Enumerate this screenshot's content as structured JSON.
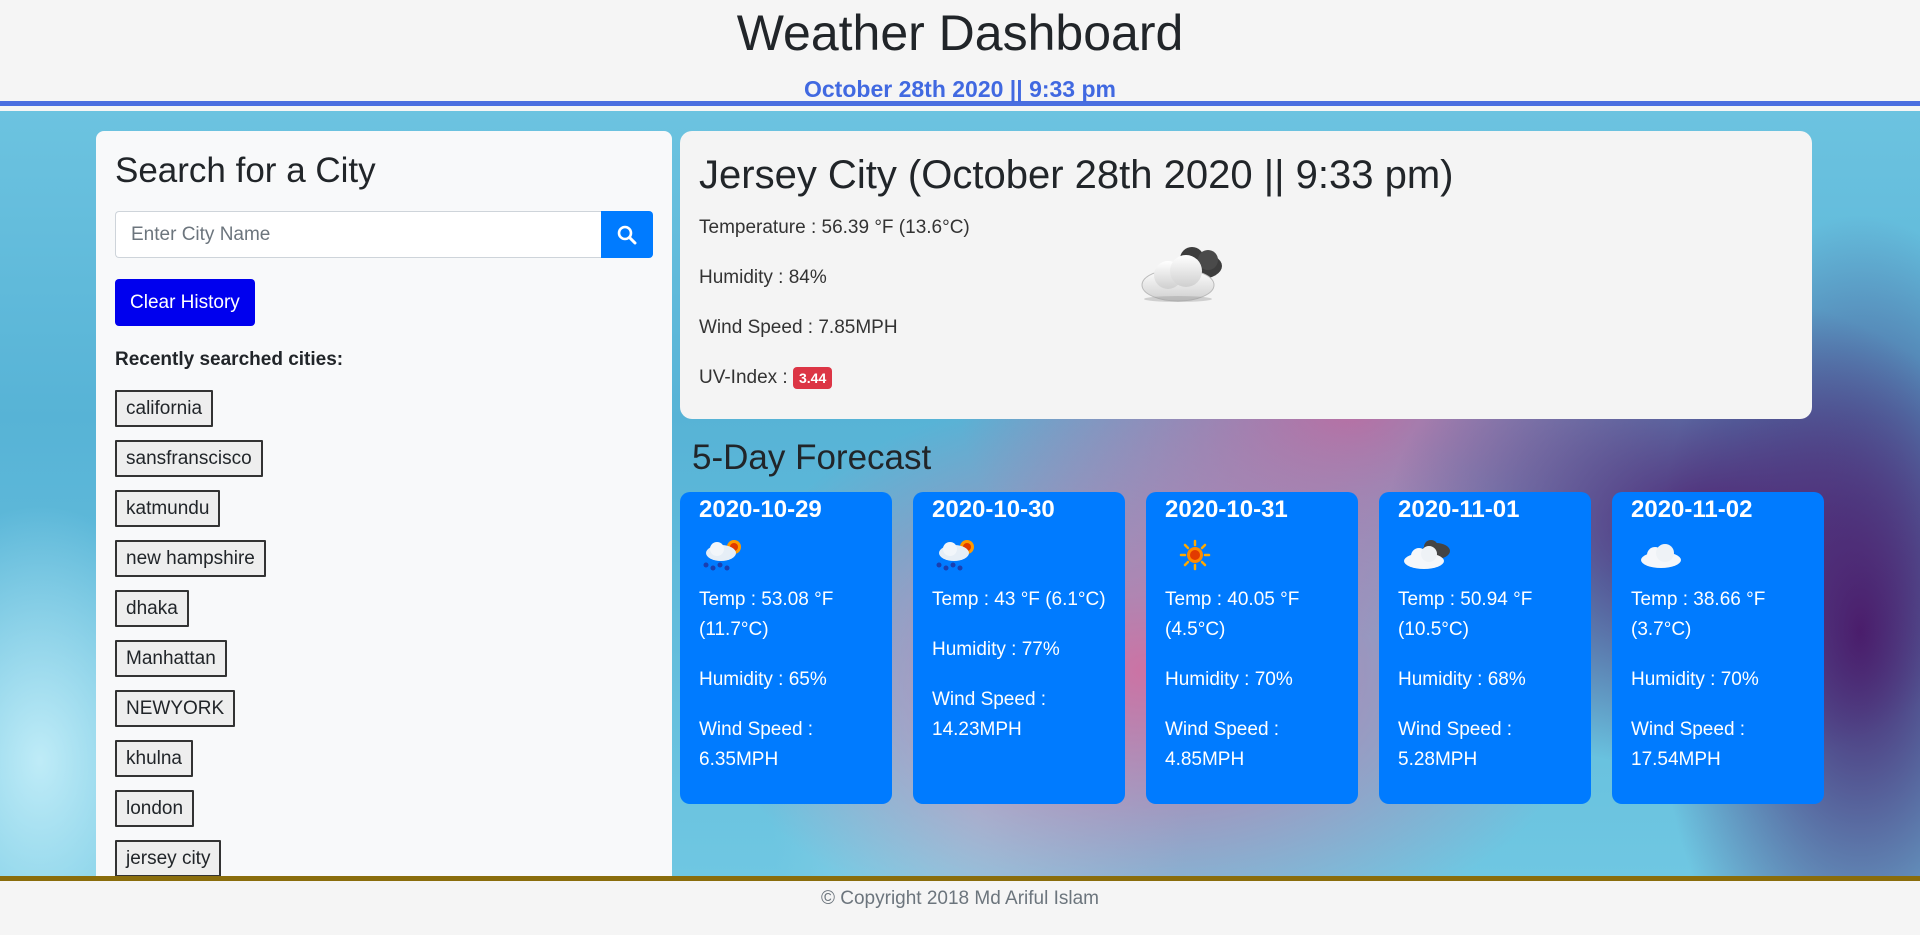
{
  "header": {
    "title": "Weather Dashboard",
    "date": "October 28th 2020 || 9:33 pm"
  },
  "sidebar": {
    "title": "Search for a City",
    "search_placeholder": "Enter City Name",
    "clear_label": "Clear History",
    "recent_label": "Recently searched cities:",
    "cities": [
      "california",
      "sansfranscisco",
      "katmundu",
      "new hampshire",
      "dhaka",
      "Manhattan",
      "NEWYORK",
      "khulna",
      "london",
      "jersey city"
    ]
  },
  "current": {
    "title": "Jersey City (October 28th 2020 || 9:33 pm)",
    "temperature": "Temperature : 56.39 °F (13.6°C)",
    "humidity": "Humidity : 84%",
    "wind": "Wind Speed : 7.85MPH",
    "uv_label": "UV-Index :",
    "uv_value": "3.44",
    "icon": "partly-cloudy-night-icon"
  },
  "forecast": {
    "title": "5-Day Forecast",
    "days": [
      {
        "date": "2020-10-29",
        "icon": "rain-sun-icon",
        "temp": "Temp : 53.08 °F (11.7°C)",
        "humidity": "Humidity : 65%",
        "wind": "Wind Speed : 6.35MPH"
      },
      {
        "date": "2020-10-30",
        "icon": "rain-sun-icon",
        "temp": "Temp : 43 °F (6.1°C)",
        "humidity": "Humidity : 77%",
        "wind": "Wind Speed : 14.23MPH"
      },
      {
        "date": "2020-10-31",
        "icon": "sun-icon",
        "temp": "Temp : 40.05 °F (4.5°C)",
        "humidity": "Humidity : 70%",
        "wind": "Wind Speed : 4.85MPH"
      },
      {
        "date": "2020-11-01",
        "icon": "partly-cloudy-icon",
        "temp": "Temp : 50.94 °F (10.5°C)",
        "humidity": "Humidity : 68%",
        "wind": "Wind Speed : 5.28MPH"
      },
      {
        "date": "2020-11-02",
        "icon": "cloud-icon",
        "temp": "Temp : 38.66 °F (3.7°C)",
        "humidity": "Humidity : 70%",
        "wind": "Wind Speed : 17.54MPH"
      }
    ]
  },
  "footer": {
    "text": "© Copyright 2018 Md Ariful Islam"
  },
  "colors": {
    "accent": "#007bff",
    "header_date": "#4169e1",
    "clear_button": "#0000ee",
    "uv_badge": "#dc3545"
  }
}
